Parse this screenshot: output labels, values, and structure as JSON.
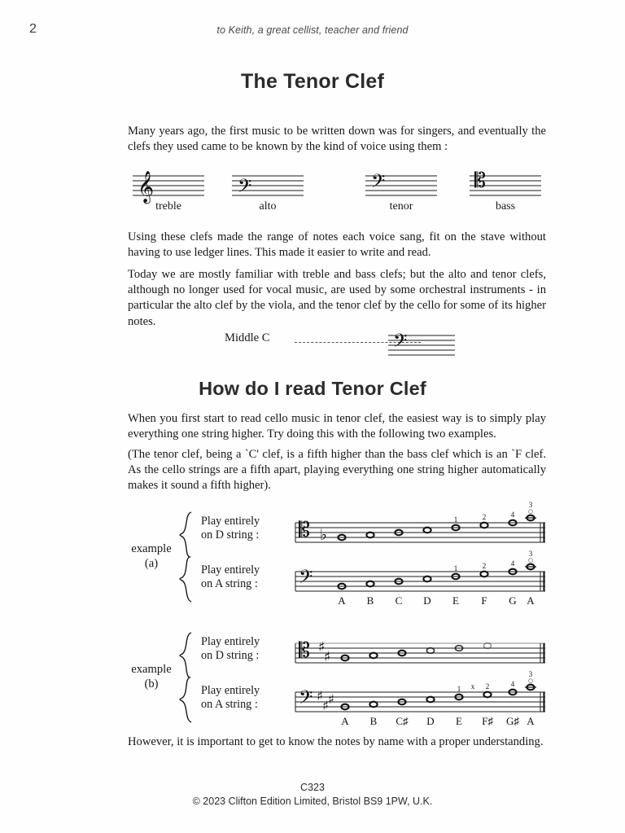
{
  "page": {
    "number": "2",
    "dedication": "to Keith, a great cellist, teacher and friend"
  },
  "headings": {
    "main": "The Tenor Clef",
    "read": "How do I read Tenor Clef"
  },
  "paragraphs": {
    "p1": "Many years ago, the first music to be written down was for singers, and eventually the clefs they used came to be known by the kind of voice using them :",
    "p2": "Using these clefs made the range of notes each voice sang, fit on the stave without having to use ledger lines. This made it easier to write and read.",
    "p3": "Today we are mostly familiar with treble and bass clefs; but the alto and tenor clefs, although no longer used for vocal music, are used by some orchestral instruments - in particular the alto clef by the viola, and the tenor clef by the cello for some of its higher notes.",
    "p4": "When you first start to read cello music in tenor clef, the easiest way is to simply play everything one string higher. Try doing this with the following two examples.",
    "p5": "(The tenor clef, being a `C' clef, is a fifth higher than the bass clef which is an `F clef. As the cello strings are a fifth apart, playing everything one string higher automatically makes it sound a fifth higher).",
    "p6": "However, it is important to get to know the notes by name with a proper understanding."
  },
  "clef_examples": [
    {
      "name": "treble",
      "clef": "treble-clef-icon",
      "caption": "treble"
    },
    {
      "name": "alto",
      "clef": "alto-clef-icon",
      "caption": "alto"
    },
    {
      "name": "tenor",
      "clef": "tenor-clef-icon",
      "caption": "tenor"
    },
    {
      "name": "bass",
      "clef": "bass-clef-icon",
      "caption": "bass"
    }
  ],
  "middle_c": {
    "label": "Middle C",
    "clef": "tenor-clef-icon"
  },
  "examples": [
    {
      "id": "a",
      "label": "example",
      "sublabel": "(a)",
      "staves": [
        {
          "instruction_line1": "Play entirely",
          "instruction_line2": "on D string :",
          "clef": "bass-clef-icon",
          "key_signature": [
            "flat"
          ],
          "fingerings": [
            "",
            "",
            "",
            "",
            "1",
            "2",
            "4",
            "3"
          ],
          "harmonic_on_last": true,
          "note_names": []
        },
        {
          "instruction_line1": "Play entirely",
          "instruction_line2": "on A string :",
          "clef": "tenor-clef-icon",
          "key_signature": [],
          "fingerings": [
            "",
            "",
            "",
            "",
            "1",
            "2",
            "4",
            "3"
          ],
          "harmonic_on_last": true,
          "note_names": [
            "A",
            "B",
            "C",
            "D",
            "E",
            "F",
            "G",
            "A"
          ]
        }
      ]
    },
    {
      "id": "b",
      "label": "example",
      "sublabel": "(b)",
      "staves": [
        {
          "instruction_line1": "Play entirely",
          "instruction_line2": "on D string :",
          "clef": "bass-clef-icon",
          "key_signature": [
            "sharp",
            "sharp"
          ],
          "fingerings": [
            "",
            "",
            "",
            "",
            "",
            "",
            "",
            ""
          ],
          "harmonic_on_last": false,
          "note_names": []
        },
        {
          "instruction_line1": "Play entirely",
          "instruction_line2": "on A string :",
          "clef": "tenor-clef-icon",
          "key_signature": [
            "sharp",
            "sharp",
            "sharp"
          ],
          "fingerings": [
            "",
            "",
            "",
            "",
            "1",
            "2",
            "4",
            "3"
          ],
          "extra_mark": "x",
          "harmonic_on_last": true,
          "note_names": [
            "A",
            "B",
            "C♯",
            "D",
            "E",
            "F♯",
            "G♯",
            "A"
          ]
        }
      ]
    }
  ],
  "footer": {
    "code": "C323",
    "copyright": "© 2023 Clifton Edition Limited, Bristol BS9 1PW,  U.K."
  }
}
